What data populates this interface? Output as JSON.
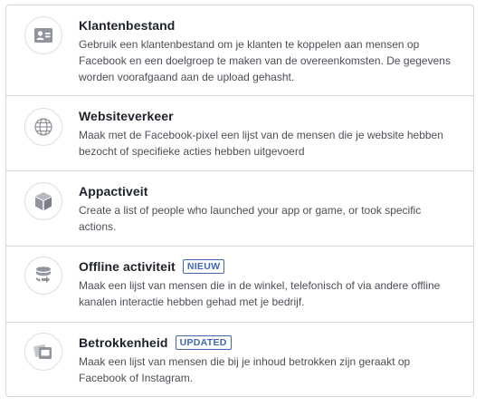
{
  "options": [
    {
      "title": "Klantenbestand",
      "description": "Gebruik een klantenbestand om je klanten te koppelen aan mensen op Facebook en een doelgroep te maken van de overeenkomsten. De gegevens worden voorafgaand aan de upload gehasht.",
      "icon": "customer-file-icon"
    },
    {
      "title": "Websiteverkeer",
      "description": "Maak met de Facebook-pixel een lijst van de mensen die je website hebben bezocht of specifieke acties hebben uitgevoerd",
      "icon": "globe-icon"
    },
    {
      "title": "Appactiveit",
      "description": "Create a list of people who launched your app or game, or took specific actions.",
      "icon": "cube-icon"
    },
    {
      "title": "Offline activiteit",
      "badge": "NIEUW",
      "description": "Maak een lijst van mensen die in de winkel, telefonisch of via andere offline kanalen interactie hebben gehad met je bedrijf.",
      "icon": "database-sync-icon"
    },
    {
      "title": "Betrokkenheid",
      "badge": "UPDATED",
      "description": "Maak een lijst van mensen die bij je inhoud betrokken zijn geraakt op Facebook of Instagram.",
      "icon": "engagement-cards-icon"
    }
  ],
  "colors": {
    "border": "#d3d6db",
    "title": "#1d2129",
    "text": "#4b4f56",
    "icon": "#90949c",
    "badge": "#4267b2"
  }
}
